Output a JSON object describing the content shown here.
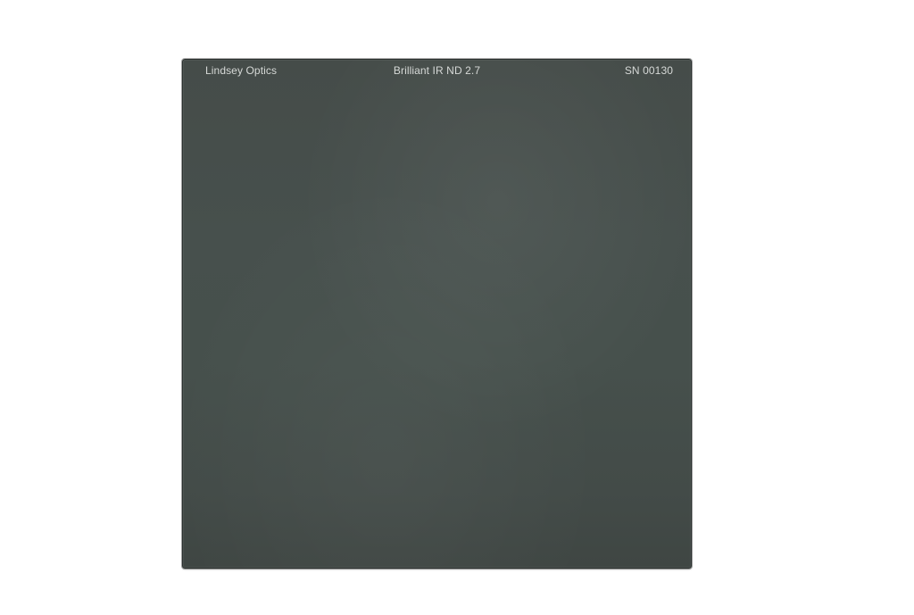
{
  "filter": {
    "brand": "Lindsey Optics",
    "model": "Brilliant IR ND 2.7",
    "serial": "SN 00130"
  },
  "colors": {
    "background": "#ffffff",
    "glass": "#464e4b",
    "engraving": "#d6d9d7"
  }
}
